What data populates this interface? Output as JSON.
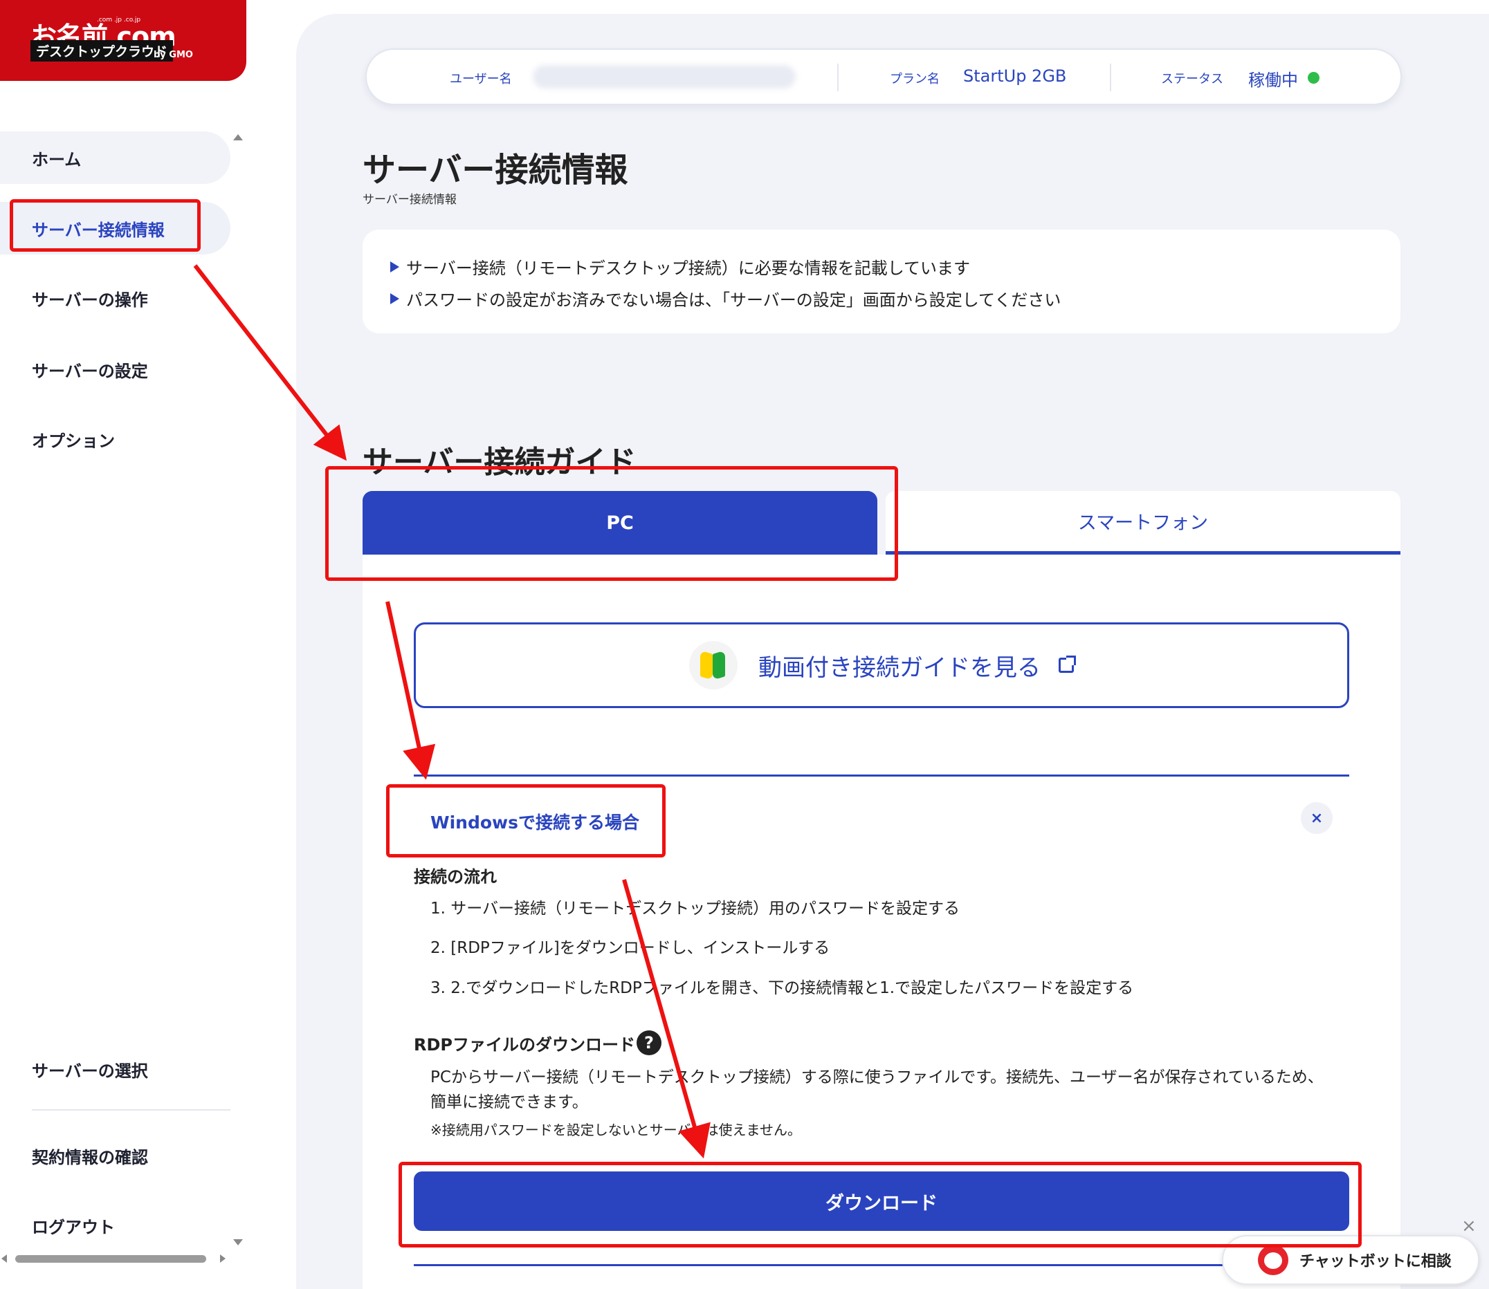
{
  "logo": {
    "main": "お名前.com",
    "tlds": ".com .jp .co.jp",
    "sub": "デスクトップクラウド",
    "by": "by GMO"
  },
  "sidebar": {
    "items": [
      {
        "label": "ホーム"
      },
      {
        "label": "サーバー接続情報"
      },
      {
        "label": "サーバーの操作"
      },
      {
        "label": "サーバーの設定"
      },
      {
        "label": "オプション"
      }
    ],
    "bottom_items": [
      {
        "label": "サーバーの選択"
      },
      {
        "label": "契約情報の確認"
      },
      {
        "label": "ログアウト"
      }
    ]
  },
  "userbar": {
    "user_label": "ユーザー名",
    "plan_label": "プラン名",
    "plan_value": "StartUp 2GB",
    "status_label": "ステータス",
    "status_value": "稼働中"
  },
  "page": {
    "title": "サーバー接続情報",
    "breadcrumb": "サーバー接続情報"
  },
  "info": {
    "lines": [
      "サーバー接続（リモートデスクトップ接続）に必要な情報を記載しています",
      "パスワードの設定がお済みでない場合は、「サーバーの設定」画面から設定してください"
    ]
  },
  "guide": {
    "title": "サーバー接続ガイド",
    "tabs": [
      "PC",
      "スマートフォン"
    ],
    "video_button": "動画付き接続ガイドを見る",
    "accordion_title": "Windowsで接続する場合",
    "close_glyph": "×",
    "flow_heading": "接続の流れ",
    "steps": [
      "1. サーバー接続（リモートデスクトップ接続）用のパスワードを設定する",
      "2. [RDPファイル]をダウンロードし、インストールする",
      "3. 2.でダウンロードしたRDPファイルを開き、下の接続情報と1.で設定したパスワードを設定する"
    ],
    "rdp_heading": "RDPファイルのダウンロード",
    "help_glyph": "?",
    "rdp_description": "PCからサーバー接続（リモートデスクトップ接続）する際に使うファイルです。接続先、ユーザー名が保存されているため、簡単に接続できます。",
    "rdp_note": "※接続用パスワードを設定しないとサーバーは使えません。",
    "download_button": "ダウンロード"
  },
  "chatbot": {
    "label": "チャットボットに相談",
    "close_glyph": "×"
  },
  "colors": {
    "brand_red": "#cc0a14",
    "accent_blue": "#2a44bf",
    "status_green": "#2fbd4a",
    "annotation_red": "#ee1111"
  }
}
